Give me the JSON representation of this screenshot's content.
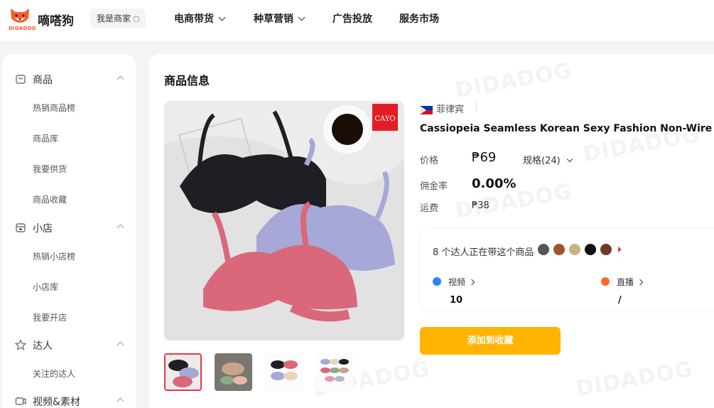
{
  "header": {
    "logo_cn": "嘀嗒狗",
    "logo_en": "DIDADOG",
    "merchant_label": "我是商家",
    "nav": [
      {
        "label": "电商带货",
        "has_dropdown": true
      },
      {
        "label": "种草营销",
        "has_dropdown": true
      },
      {
        "label": "广告投放",
        "has_dropdown": false
      },
      {
        "label": "服务市场",
        "has_dropdown": false
      }
    ]
  },
  "sidebar": {
    "groups": [
      {
        "label": "商品",
        "icon": "product-icon",
        "items": [
          "热销商品榜",
          "商品库",
          "我要供货",
          "商品收藏"
        ]
      },
      {
        "label": "小店",
        "icon": "shop-icon",
        "items": [
          "热销小店榜",
          "小店库",
          "我要开店"
        ]
      },
      {
        "label": "达人",
        "icon": "star-icon",
        "items": [
          "关注的达人"
        ]
      },
      {
        "label": "视频&素材",
        "icon": "video-icon",
        "items": []
      }
    ]
  },
  "main": {
    "section_title": "商品信息",
    "watermark": "DIDADOG",
    "image_brand": "CAYO",
    "region": "菲律宾",
    "product_title": "Cassiopeia Seamless Korean Sexy Fashion Non-Wire Thin",
    "price_label": "价格",
    "price": "₱69",
    "spec_label": "规格(24)",
    "commission_label": "佣金率",
    "commission": "0.00%",
    "shipping_label": "运费",
    "shipping": "₱38",
    "influencers": {
      "text": "8 个达人正在带这个商品",
      "avatar_colors": [
        "#555555",
        "#a0522d",
        "#c9b089",
        "#111111",
        "#6b3a2a"
      ],
      "video_label": "视频",
      "video_value": "10",
      "live_label": "直播",
      "live_value": "/"
    },
    "favorite_button": "添加到收藏",
    "thumb_count": 4
  },
  "colors": {
    "accent": "#ffb400",
    "brand": "#ff5a2a",
    "video_icon": "#2f80ff",
    "live_icon": "#ff6a2a"
  }
}
